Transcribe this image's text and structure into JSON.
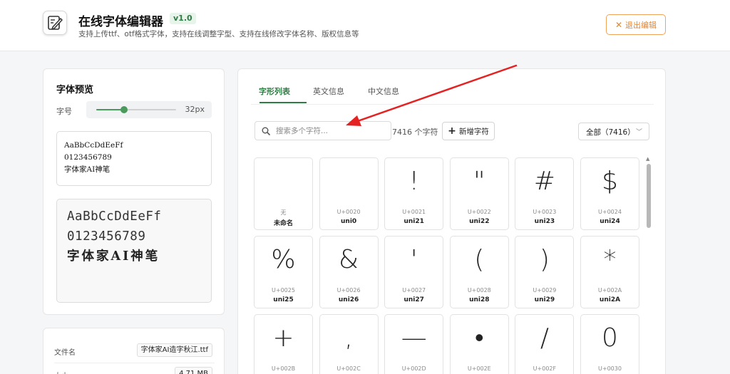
{
  "header": {
    "title": "在线字体编辑器",
    "version": "v1.0",
    "subtitle": "支持上传ttf、otf格式字体，支持在线调整字型、支持在线修改字体名称、版权信息等",
    "exit_label": "退出编辑",
    "logo_icon": "pen-edit-icon"
  },
  "preview": {
    "title": "字体预览",
    "size_label": "字号",
    "size_value": "32px",
    "slider_fraction": 0.35,
    "input_lines": [
      "AaBbCcDdEeFf",
      "0123456789",
      "字体家AI神笔"
    ],
    "render_lines": [
      "AaBbCcDdEeFf",
      "0123456789",
      "字体家AI神笔"
    ]
  },
  "file_info": {
    "rows": [
      {
        "label": "文件名",
        "value": "字体家AI造字秋江.ttf"
      },
      {
        "label": "大小",
        "value": "4.71 MB"
      }
    ]
  },
  "tabs": [
    {
      "label": "字形列表",
      "active": true
    },
    {
      "label": "英文信息",
      "active": false
    },
    {
      "label": "中文信息",
      "active": false
    }
  ],
  "toolbar": {
    "search_placeholder": "搜索多个字符...",
    "glyph_count": "7416 个字符",
    "add_label": "新增字符",
    "filter_value": "全部（7416）"
  },
  "glyphs": [
    {
      "glyph": "",
      "code": "无",
      "name": "未命名"
    },
    {
      "glyph": "",
      "code": "U+0020",
      "name": "uni0"
    },
    {
      "glyph": "!",
      "code": "U+0021",
      "name": "uni21"
    },
    {
      "glyph": "\"",
      "code": "U+0022",
      "name": "uni22"
    },
    {
      "glyph": "#",
      "code": "U+0023",
      "name": "uni23"
    },
    {
      "glyph": "$",
      "code": "U+0024",
      "name": "uni24"
    },
    {
      "glyph": "%",
      "code": "U+0025",
      "name": "uni25"
    },
    {
      "glyph": "&",
      "code": "U+0026",
      "name": "uni26"
    },
    {
      "glyph": "'",
      "code": "U+0027",
      "name": "uni27"
    },
    {
      "glyph": "(",
      "code": "U+0028",
      "name": "uni28"
    },
    {
      "glyph": ")",
      "code": "U+0029",
      "name": "uni29"
    },
    {
      "glyph": "*",
      "code": "U+002A",
      "name": "uni2A"
    },
    {
      "glyph": "+",
      "code": "U+002B",
      "name": ""
    },
    {
      "glyph": ",",
      "code": "U+002C",
      "name": ""
    },
    {
      "glyph": "—",
      "code": "U+002D",
      "name": ""
    },
    {
      "glyph": "•",
      "code": "U+002E",
      "name": ""
    },
    {
      "glyph": "/",
      "code": "U+002F",
      "name": ""
    },
    {
      "glyph": "0",
      "code": "U+0030",
      "name": ""
    }
  ],
  "colors": {
    "accent": "#2f7d44",
    "exit": "#e8842a",
    "annotation_arrow": "#e52222"
  }
}
